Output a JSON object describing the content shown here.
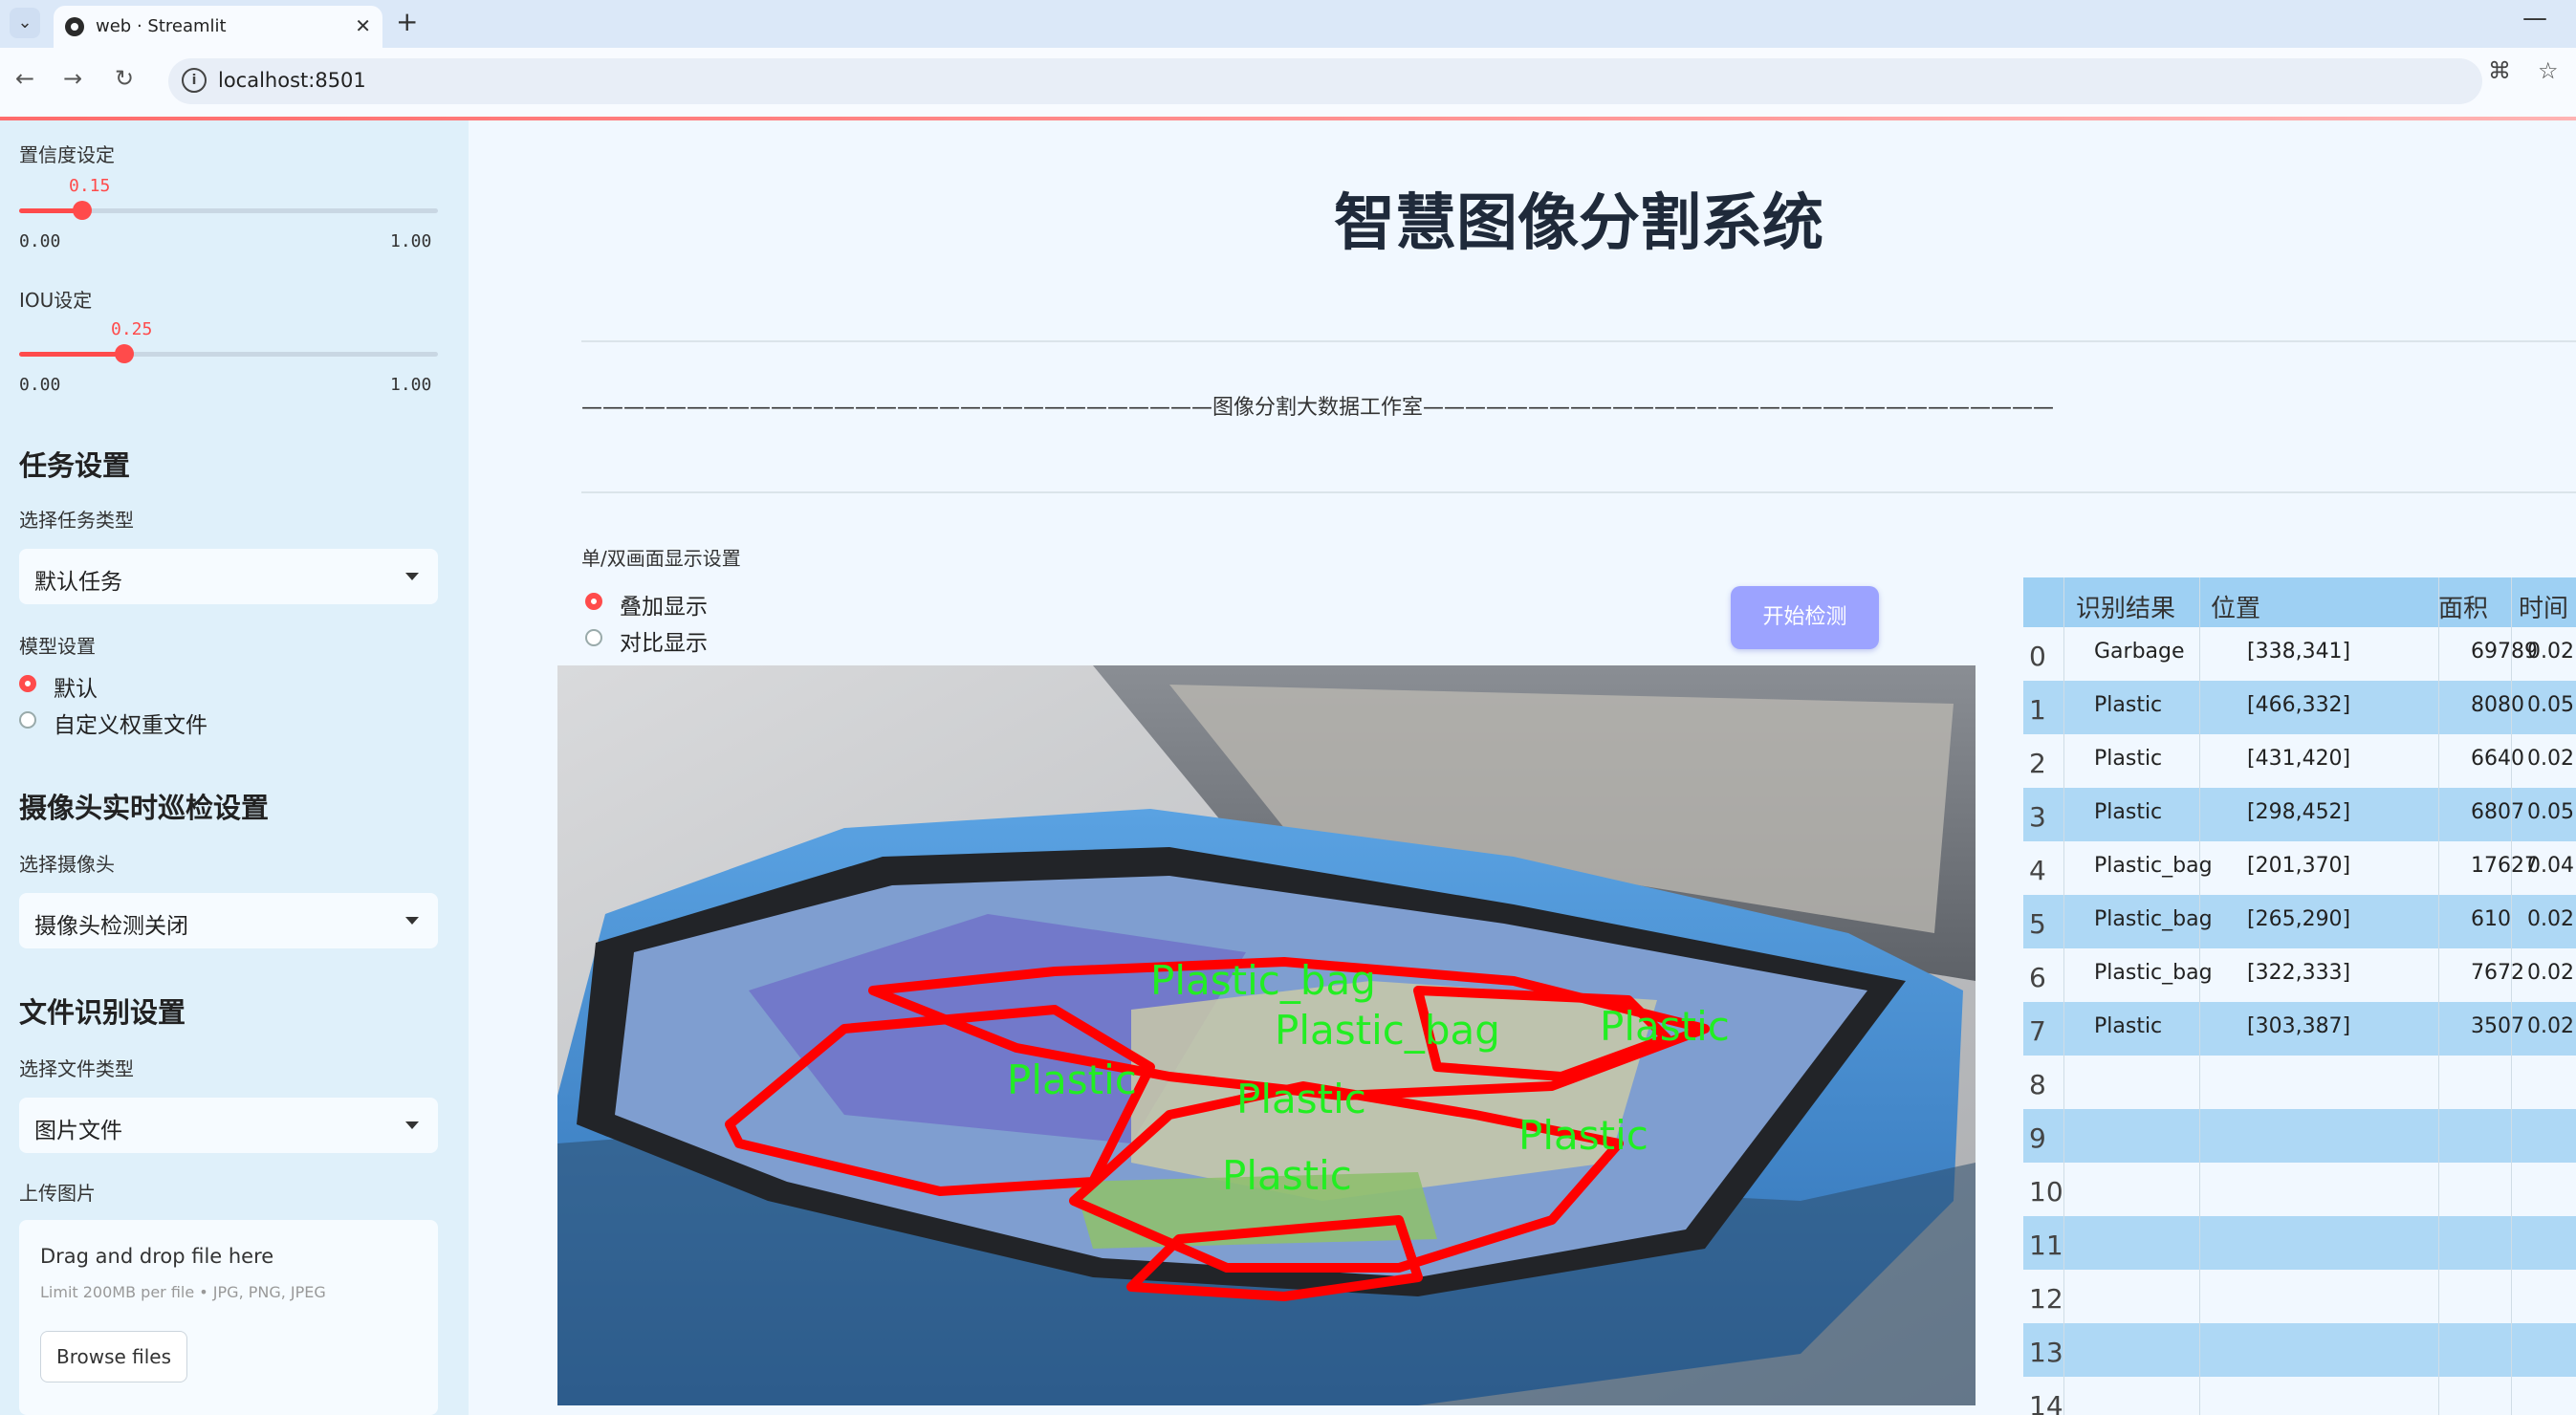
{
  "browser": {
    "tab_title": "web · Streamlit",
    "url": "localhost:8501"
  },
  "sidebar": {
    "confidence": {
      "label": "置信度设定",
      "value": "0.15",
      "min": "0.00",
      "max": "1.00",
      "fraction": 0.15
    },
    "iou": {
      "label": "IOU设定",
      "value": "0.25",
      "min": "0.00",
      "max": "1.00",
      "fraction": 0.25
    },
    "task_heading": "任务设置",
    "task_type_label": "选择任务类型",
    "task_type_value": "默认任务",
    "model_label": "模型设置",
    "model_options": [
      "默认",
      "自定义权重文件"
    ],
    "model_selected": 0,
    "camera_heading": "摄像头实时巡检设置",
    "camera_label": "选择摄像头",
    "camera_value": "摄像头检测关闭",
    "file_heading": "文件识别设置",
    "file_type_label": "选择文件类型",
    "file_type_value": "图片文件",
    "upload_label": "上传图片",
    "upload_title": "Drag and drop file here",
    "upload_limit": "Limit 200MB per file • JPG, PNG, JPEG",
    "browse_label": "Browse files"
  },
  "main": {
    "title": "智慧图像分割系统",
    "studio_line": "——————————————————————————————图像分割大数据工作室——————————————————————————————",
    "display_label": "单/双画面显示设置",
    "display_options": [
      "叠加显示",
      "对比显示"
    ],
    "display_selected": 0,
    "start_button": "开始检测"
  },
  "detections": {
    "labels": [
      "Plastic_bag",
      "Plastic_bag",
      "Plastic",
      "Plastic",
      "Plastic",
      "Plastic",
      "Plastic"
    ]
  },
  "table": {
    "headers": [
      "识别结果",
      "位置",
      "面积",
      "时间"
    ],
    "rows": [
      {
        "idx": "0",
        "result": "Garbage",
        "pos": "[338,341]",
        "area": "69789",
        "time": "0.02"
      },
      {
        "idx": "1",
        "result": "Plastic",
        "pos": "[466,332]",
        "area": "8080",
        "time": "0.05"
      },
      {
        "idx": "2",
        "result": "Plastic",
        "pos": "[431,420]",
        "area": "6640",
        "time": "0.02"
      },
      {
        "idx": "3",
        "result": "Plastic",
        "pos": "[298,452]",
        "area": "6807",
        "time": "0.05"
      },
      {
        "idx": "4",
        "result": "Plastic_bag",
        "pos": "[201,370]",
        "area": "17627",
        "time": "0.04"
      },
      {
        "idx": "5",
        "result": "Plastic_bag",
        "pos": "[265,290]",
        "area": "610",
        "time": "0.02"
      },
      {
        "idx": "6",
        "result": "Plastic_bag",
        "pos": "[322,333]",
        "area": "7672",
        "time": "0.02"
      },
      {
        "idx": "7",
        "result": "Plastic",
        "pos": "[303,387]",
        "area": "3507",
        "time": "0.02"
      },
      {
        "idx": "8",
        "result": "",
        "pos": "",
        "area": "",
        "time": ""
      },
      {
        "idx": "9",
        "result": "",
        "pos": "",
        "area": "",
        "time": ""
      },
      {
        "idx": "10",
        "result": "",
        "pos": "",
        "area": "",
        "time": ""
      },
      {
        "idx": "11",
        "result": "",
        "pos": "",
        "area": "",
        "time": ""
      },
      {
        "idx": "12",
        "result": "",
        "pos": "",
        "area": "",
        "time": ""
      },
      {
        "idx": "13",
        "result": "",
        "pos": "",
        "area": "",
        "time": ""
      },
      {
        "idx": "14",
        "result": "",
        "pos": "",
        "area": "",
        "time": ""
      }
    ]
  },
  "colors": {
    "accent": "#ff4b4b",
    "sidebar_bg": "#dff0fa",
    "table_header": "#9ed0f3",
    "table_stripe": "#aed8f5",
    "button": "#9ca3ff",
    "mask_outline": "#ff0000",
    "mask_label": "#22ee22"
  }
}
